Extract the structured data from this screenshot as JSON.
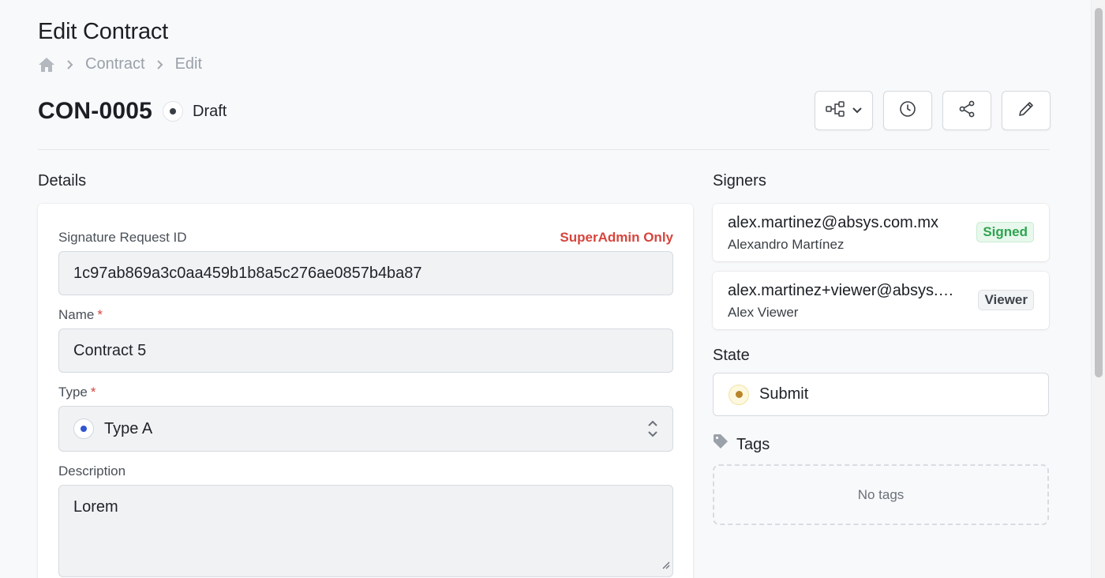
{
  "page": {
    "title": "Edit Contract",
    "breadcrumb": [
      "Contract",
      "Edit"
    ]
  },
  "record": {
    "id": "CON-0005",
    "status": "Draft"
  },
  "sections": {
    "details": "Details",
    "signers": "Signers",
    "state": "State",
    "tags": "Tags"
  },
  "form": {
    "signature_request_id": {
      "label": "Signature Request ID",
      "note": "SuperAdmin Only",
      "value": "1c97ab869a3c0aa459b1b8a5c276ae0857b4ba87"
    },
    "name": {
      "label": "Name",
      "required_mark": "*",
      "value": "Contract 5"
    },
    "type": {
      "label": "Type",
      "required_mark": "*",
      "value": "Type A"
    },
    "description": {
      "label": "Description",
      "value": "Lorem"
    }
  },
  "signers": [
    {
      "email": "alex.martinez@absys.com.mx",
      "name": "Alexandro Martínez",
      "badge": "Signed"
    },
    {
      "email": "alex.martinez+viewer@absys.com.mx",
      "name": "Alex Viewer",
      "badge": "Viewer"
    }
  ],
  "state": {
    "value": "Submit"
  },
  "tags": {
    "empty_text": "No tags"
  },
  "icons": {
    "breadcrumb_home": "home-icon",
    "toolbar": [
      "workflow-icon",
      "history-icon",
      "share-icon",
      "edit-icon"
    ],
    "tags": "tag-icon"
  },
  "colors": {
    "required": "#d6453d",
    "signed_badge": "#2ea44f",
    "type_dot": "#2f55d4",
    "state_dot": "#b9842a"
  }
}
